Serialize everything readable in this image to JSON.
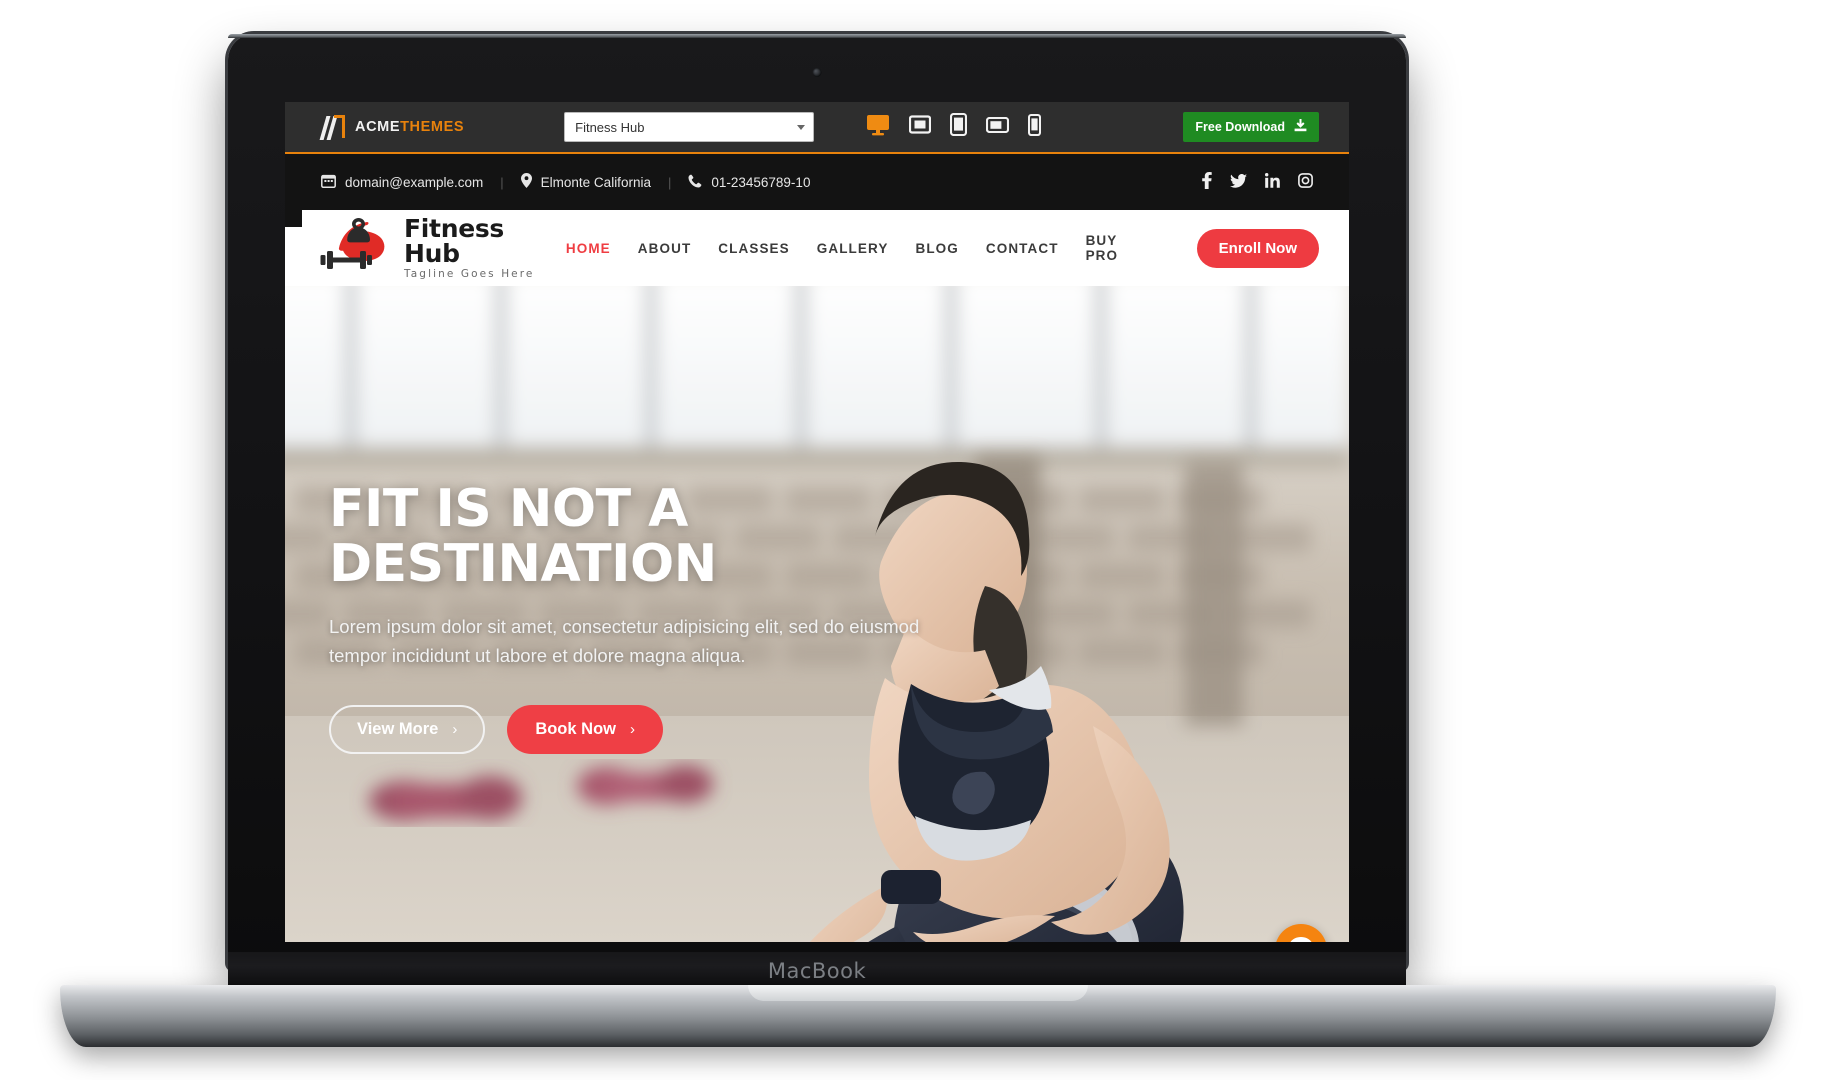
{
  "device": {
    "brand_label": "MacBook"
  },
  "preview_toolbar": {
    "logo_text_primary": "ACME",
    "logo_text_secondary": "THEMES",
    "logo_icon": "acmethemes-a-mark-icon",
    "theme_select": {
      "value": "Fitness Hub",
      "icon": "chevron-down-icon"
    },
    "devices": [
      {
        "name": "desktop-preview",
        "icon": "desktop-icon",
        "active": true
      },
      {
        "name": "laptop-preview",
        "icon": "laptop-icon",
        "active": false
      },
      {
        "name": "tablet-preview",
        "icon": "tablet-icon",
        "active": false
      },
      {
        "name": "tablet-landscape-preview",
        "icon": "tablet-landscape-icon",
        "active": false
      },
      {
        "name": "mobile-preview",
        "icon": "mobile-icon",
        "active": false
      }
    ],
    "free_download": {
      "label": "Free Download",
      "icon": "download-icon",
      "color": "#1f8b22"
    }
  },
  "site": {
    "topbar": {
      "email": "domain@example.com",
      "email_icon": "envelope-icon",
      "location": "Elmonte California",
      "location_icon": "map-pin-icon",
      "phone": "01-23456789-10",
      "phone_icon": "phone-icon",
      "separator": "|",
      "socials": [
        {
          "name": "facebook",
          "icon": "facebook-icon",
          "glyph": "f"
        },
        {
          "name": "twitter",
          "icon": "twitter-icon",
          "glyph": "t"
        },
        {
          "name": "linkedin",
          "icon": "linkedin-icon",
          "glyph": "in"
        },
        {
          "name": "instagram",
          "icon": "instagram-icon",
          "glyph": "ig"
        }
      ]
    },
    "brand": {
      "name": "Fitness Hub",
      "tagline": "Tagline Goes Here",
      "logo_icon": "kettlebell-dumbbell-logo-icon"
    },
    "menu": [
      {
        "label": "HOME",
        "active": true
      },
      {
        "label": "ABOUT",
        "active": false
      },
      {
        "label": "CLASSES",
        "active": false
      },
      {
        "label": "GALLERY",
        "active": false
      },
      {
        "label": "BLOG",
        "active": false
      },
      {
        "label": "CONTACT",
        "active": false
      },
      {
        "label": "BUY PRO",
        "active": false
      }
    ],
    "cta_nav": {
      "label": "Enroll Now",
      "color": "#ee3b41"
    },
    "hero": {
      "title": "FIT IS NOT A DESTINATION",
      "subtitle": "Lorem ipsum dolor sit amet, consectetur adipisicing elit, sed do eiusmod tempor incididunt ut labore et dolore magna aliqua.",
      "buttons": [
        {
          "label": "View More",
          "style": "outline",
          "arrow": "›"
        },
        {
          "label": "Book Now",
          "style": "solid",
          "arrow": "›",
          "color": "#ef3f45"
        }
      ],
      "background_description": "woman stretching on gym floor with pink yoga mat, brick wall and windows"
    },
    "chat_widget": {
      "icon": "chat-bubble-icon",
      "color": "#f58410"
    }
  },
  "colors": {
    "accent_red": "#ee3b41",
    "accent_orange": "#e8820c",
    "download_green": "#1f8b22",
    "toolbar_dark": "#2e2e2e",
    "topbar_dark": "#131313"
  }
}
